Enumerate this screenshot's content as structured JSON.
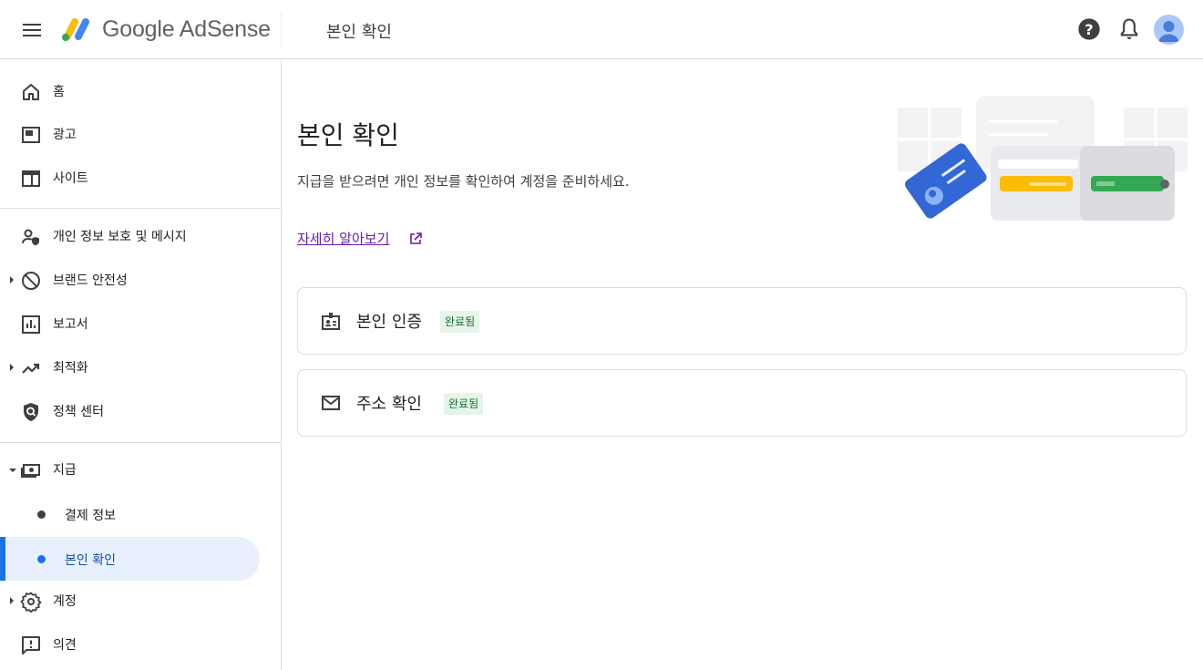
{
  "header": {
    "brand": "Google AdSense",
    "page_title": "본인 확인"
  },
  "sidebar": {
    "items": [
      {
        "label": "홈",
        "icon": "home-icon"
      },
      {
        "label": "광고",
        "icon": "ads-icon"
      },
      {
        "label": "사이트",
        "icon": "sites-icon"
      },
      {
        "label": "개인 정보 보호 및 메시지",
        "icon": "privacy-icon"
      },
      {
        "label": "브랜드 안전성",
        "icon": "block-icon"
      },
      {
        "label": "보고서",
        "icon": "reports-icon"
      },
      {
        "label": "최적화",
        "icon": "trending-icon"
      },
      {
        "label": "정책 센터",
        "icon": "policy-shield-icon"
      },
      {
        "label": "지급",
        "icon": "payments-icon"
      },
      {
        "label": "계정",
        "icon": "gear-icon"
      },
      {
        "label": "의견",
        "icon": "feedback-icon"
      }
    ],
    "payments_sub": [
      {
        "label": "결제 정보"
      },
      {
        "label": "본인 확인"
      }
    ]
  },
  "main": {
    "title": "본인 확인",
    "description": "지급을 받으려면 개인 정보를 확인하여 계정을 준비하세요.",
    "learn_more": "자세히 알아보기",
    "cards": [
      {
        "label": "본인 인증",
        "status": "완료됨",
        "icon": "id-badge-icon"
      },
      {
        "label": "주소 확인",
        "status": "완료됨",
        "icon": "mail-icon"
      }
    ]
  },
  "colors": {
    "accent": "#1a73e8",
    "badge_bg": "#e6f4ea",
    "badge_text": "#137333",
    "link": "#681da8"
  }
}
